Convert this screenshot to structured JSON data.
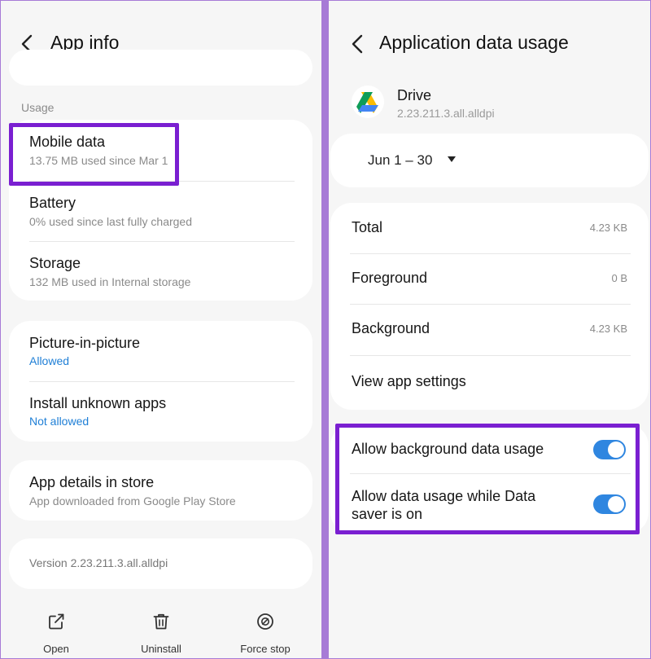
{
  "left": {
    "header": {
      "title": "App info"
    },
    "usage_section": {
      "label": "Usage"
    },
    "usage_items": [
      {
        "title": "Mobile data",
        "subtitle": "13.75 MB used since Mar 1"
      },
      {
        "title": "Battery",
        "subtitle": "0% used since last fully charged"
      },
      {
        "title": "Storage",
        "subtitle": "132 MB used in Internal storage"
      }
    ],
    "permission_items": [
      {
        "title": "Picture-in-picture",
        "subtitle": "Allowed"
      },
      {
        "title": "Install unknown apps",
        "subtitle": "Not allowed"
      }
    ],
    "store_item": {
      "title": "App details in store",
      "subtitle": "App downloaded from Google Play Store"
    },
    "version": "Version 2.23.211.3.all.alldpi",
    "bottom_bar": [
      {
        "label": "Open",
        "icon": "open-external-icon"
      },
      {
        "label": "Uninstall",
        "icon": "trash-icon"
      },
      {
        "label": "Force stop",
        "icon": "force-stop-icon"
      }
    ]
  },
  "right": {
    "header": {
      "title": "Application data usage"
    },
    "app": {
      "name": "Drive",
      "version": "2.23.211.3.all.alldpi",
      "icon": "google-drive-icon"
    },
    "date_range": "Jun 1 – 30",
    "usage_rows": [
      {
        "label": "Total",
        "value": "4.23 KB"
      },
      {
        "label": "Foreground",
        "value": "0 B"
      },
      {
        "label": "Background",
        "value": "4.23 KB"
      }
    ],
    "view_settings": "View app settings",
    "toggles": [
      {
        "label_line1": "Allow background data usage",
        "label_line2": "",
        "on": true
      },
      {
        "label_line1": "Allow data usage while Data",
        "label_line2": "saver is on",
        "on": true
      }
    ]
  },
  "colors": {
    "highlight": "#7a1fd1",
    "toggle_on": "#2f86e0",
    "link_blue": "#1f7fd6",
    "background": "#f6f6f6",
    "frame": "#a77bd6"
  }
}
